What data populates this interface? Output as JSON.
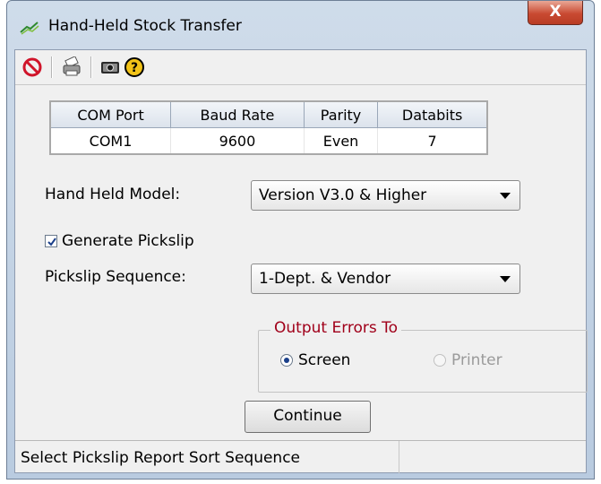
{
  "window": {
    "title": "Hand-Held Stock Transfer",
    "close_label": "X"
  },
  "toolbar": {
    "icons": [
      "stop-icon",
      "printer-icon",
      "camera-icon",
      "help-icon"
    ]
  },
  "com_table": {
    "headers": [
      "COM Port",
      "Baud Rate",
      "Parity",
      "Databits"
    ],
    "row": [
      "COM1",
      "9600",
      "Even",
      "7"
    ]
  },
  "form": {
    "hand_held_model_label": "Hand Held Model:",
    "hand_held_model_value": "Version V3.0 & Higher",
    "generate_pickslip_label": "Generate Pickslip",
    "generate_pickslip_checked": true,
    "pickslip_sequence_label": "Pickslip Sequence:",
    "pickslip_sequence_value": "1-Dept. & Vendor"
  },
  "output_errors": {
    "title": "Output  Errors To",
    "screen_label": "Screen",
    "printer_label": "Printer",
    "selected": "Screen"
  },
  "buttons": {
    "continue_label": "Continue"
  },
  "status_bar": {
    "text": "Select Pickslip Report Sort Sequence"
  },
  "colors": {
    "group_title": "#a0001a",
    "close_button": "#c94a32"
  }
}
